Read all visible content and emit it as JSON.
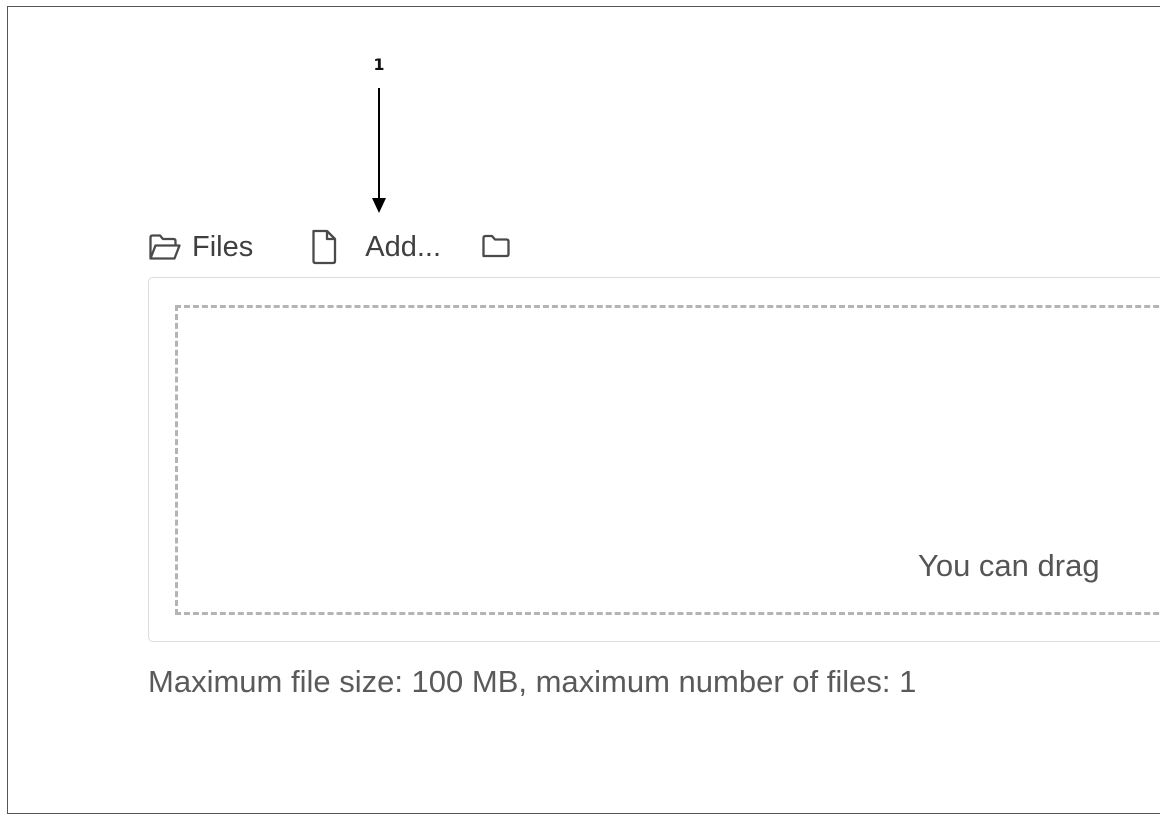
{
  "annotation": {
    "number": "1"
  },
  "toolbar": {
    "files_label": "Files",
    "add_label": "Add...",
    "icons": {
      "files": "folder-open-icon",
      "add_file": "file-icon",
      "create_folder": "folder-icon"
    }
  },
  "dropzone": {
    "message": "You can drag"
  },
  "limits": {
    "text": "Maximum file size: 100 MB, maximum number of files: 1"
  }
}
